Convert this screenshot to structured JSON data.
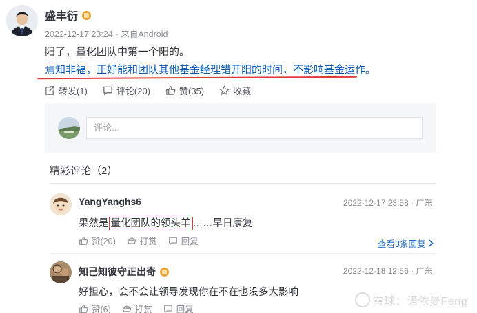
{
  "post": {
    "author": "盛丰衍",
    "date": "2022-12-17 23:24",
    "source": "· 来自Android",
    "line1": "阳了，量化团队中第一个阳的。",
    "line2": "焉知非福，正好能和团队其他基金经理错开阳的时间，不影响基金运作。",
    "actions": {
      "repost": "转发(1)",
      "comment": "评论(20)",
      "like": "赞(35)",
      "favorite": "收藏"
    }
  },
  "comment_box": {
    "placeholder": "评论..."
  },
  "comments_section": {
    "title": "精彩评论（2）"
  },
  "comments": [
    {
      "author": "YangYanghs6",
      "time": "2022-12-17 23:58 · 广东",
      "text_before": "果然是",
      "text_highlight": "量化团队的领头羊",
      "text_after": "……早日康复",
      "like": "赞(20)",
      "tip": "打赏",
      "reply": "回复",
      "view_replies": "查看3条回复"
    },
    {
      "author": "知己知彼守正出奇",
      "time": "2022-12-18 12:56 · 广东",
      "text": "好担心，会不会让领导发现你在不在也没多大影响",
      "like": "赞(6)",
      "tip": "打赏",
      "reply": "回复"
    }
  ],
  "watermark": "雪球：诺依曼Feng",
  "colors": {
    "link_blue": "#0a5bb5",
    "annotation_red": "#e23b3b",
    "reply_blue": "#1e68c4",
    "verified_gold": "#f0a334"
  }
}
